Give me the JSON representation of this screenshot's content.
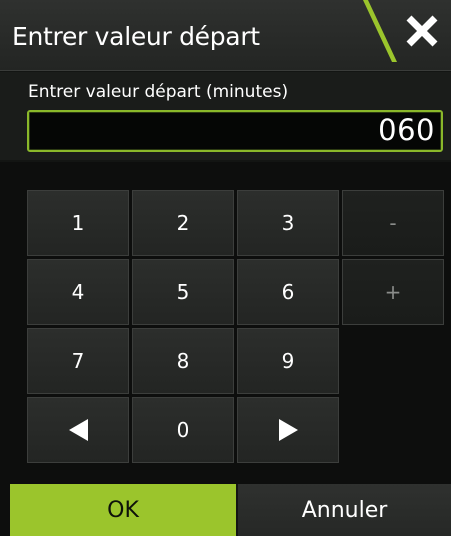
{
  "dialog": {
    "title": "Entrer valeur départ",
    "accent_color": "#9bc52c"
  },
  "input": {
    "label": "Entrer valeur départ (minutes)",
    "value": "060"
  },
  "keypad": {
    "keys": [
      "1",
      "2",
      "3",
      "-",
      "4",
      "5",
      "6",
      "+",
      "7",
      "8",
      "9",
      "0"
    ],
    "left_icon": "arrow-left-icon",
    "right_icon": "arrow-right-icon"
  },
  "buttons": {
    "ok_label": "OK",
    "cancel_label": "Annuler"
  },
  "icons": {
    "close": "close-icon"
  }
}
